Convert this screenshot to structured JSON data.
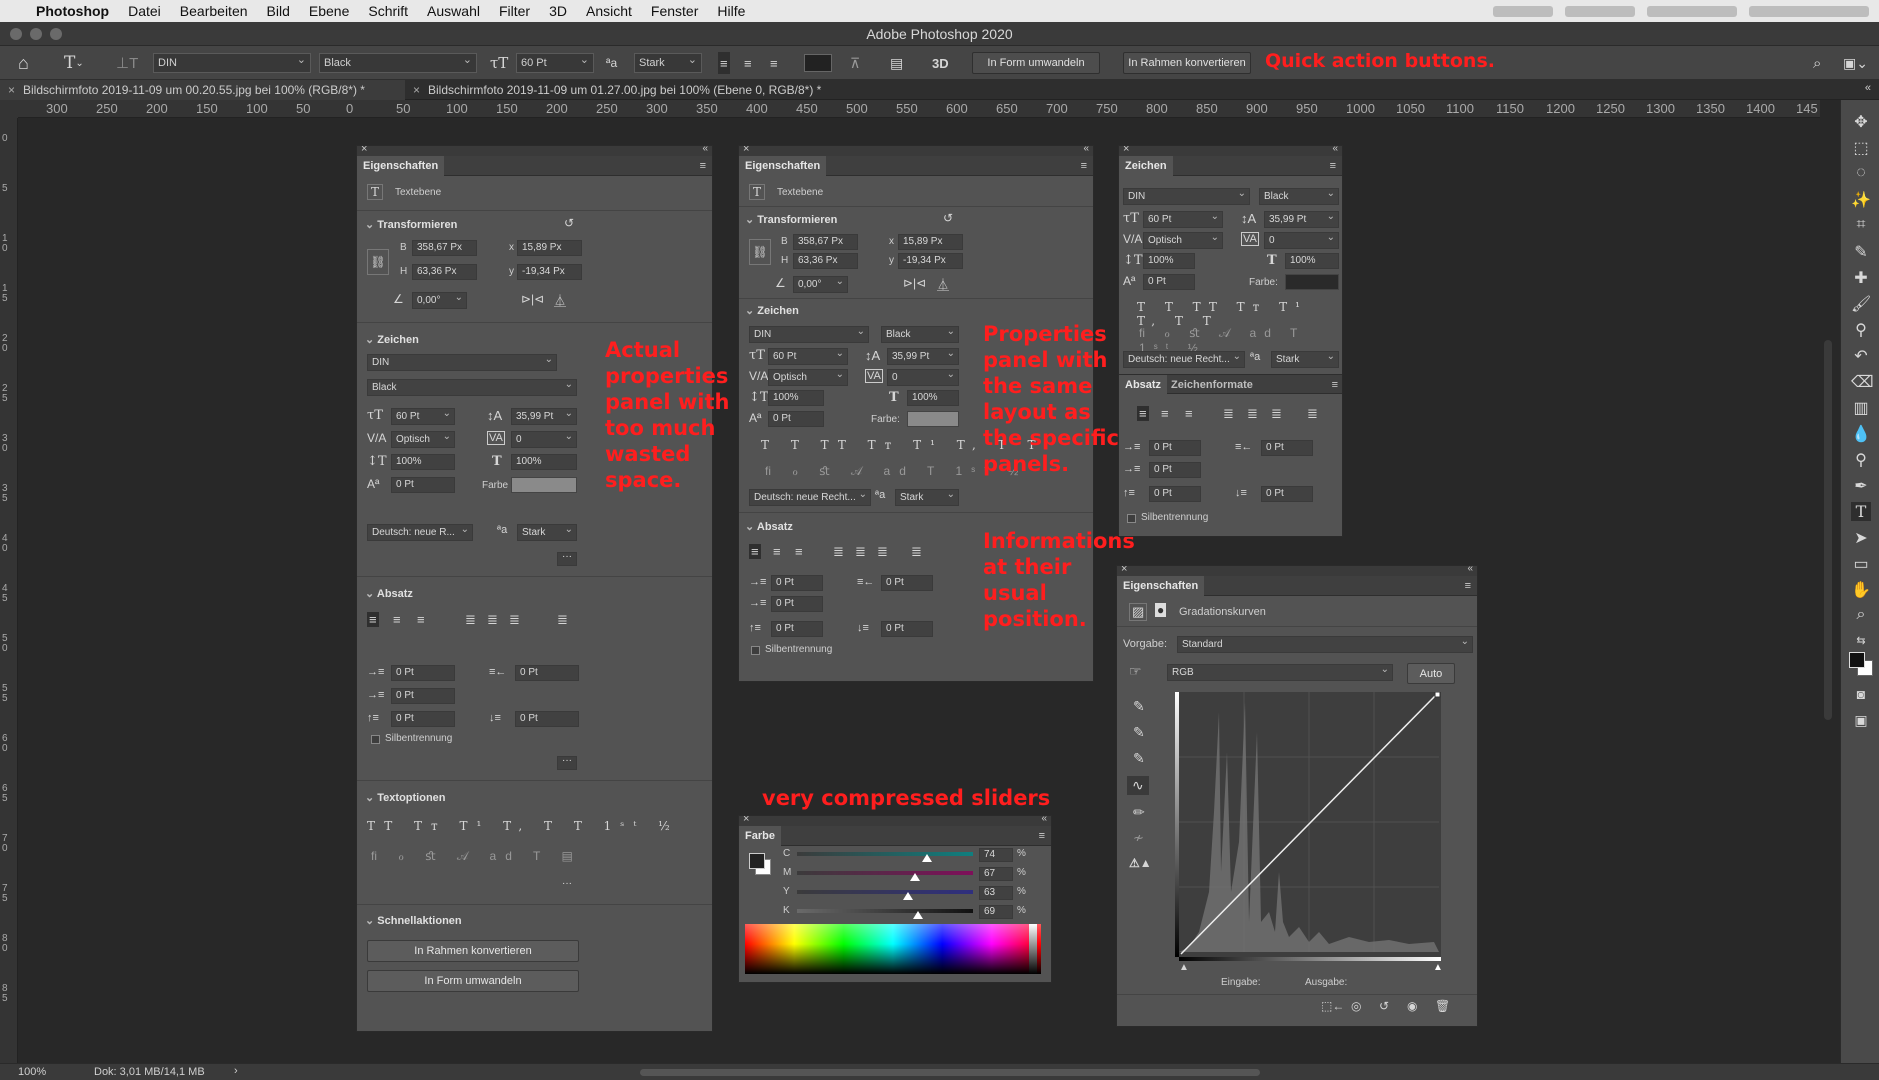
{
  "menubar": {
    "app": "Photoshop",
    "items": [
      "Datei",
      "Bearbeiten",
      "Bild",
      "Ebene",
      "Schrift",
      "Auswahl",
      "Filter",
      "3D",
      "Ansicht",
      "Fenster",
      "Hilfe"
    ]
  },
  "window_title": "Adobe Photoshop 2020",
  "options_bar": {
    "font_family": "DIN",
    "font_style": "Black",
    "font_size": "60 Pt",
    "antialias": "Stark",
    "btn_3d": "3D",
    "btn_convert_shape": "In Form umwandeln",
    "btn_convert_frame": "In Rahmen konvertieren",
    "annotation": "Quick action buttons."
  },
  "tabs": [
    {
      "label": "Bildschirmfoto 2019-11-09 um 00.20.55.jpg bei 100% (RGB/8*) *"
    },
    {
      "label": "Bildschirmfoto 2019-11-09 um 01.27.00.jpg bei 100% (Ebene 0, RGB/8*) *"
    }
  ],
  "ruler_top": [
    "300",
    "250",
    "200",
    "150",
    "100",
    "50",
    "0",
    "50",
    "100",
    "150",
    "200",
    "250",
    "300",
    "350",
    "400",
    "450",
    "500",
    "550",
    "600",
    "650",
    "700",
    "750",
    "800",
    "850",
    "900",
    "950",
    "1000",
    "1050",
    "1100",
    "1150",
    "1200",
    "1250",
    "1300",
    "1350",
    "1400",
    "145"
  ],
  "ruler_left": [
    "0",
    "5",
    "1 0",
    "1 5",
    "2 0",
    "2 5",
    "3 0",
    "3 5",
    "4 0",
    "4 5",
    "5 0",
    "5 5",
    "6 0",
    "6 5",
    "7 0",
    "7 5",
    "8 0",
    "8 5"
  ],
  "props_big": {
    "title": "Eigenschaften",
    "layer_type": "Textebene",
    "sec_transform": "Transformieren",
    "b_label": "B",
    "b_value": "358,67 Px",
    "x_label": "x",
    "x_value": "15,89 Px",
    "h_label": "H",
    "h_value": "63,36 Px",
    "y_label": "y",
    "y_value": "-19,34 Px",
    "angle": "0,00°",
    "sec_char": "Zeichen",
    "font": "DIN",
    "style": "Black",
    "size": "60 Pt",
    "leading": "35,99 Pt",
    "kerning": "Optisch",
    "tracking": "0",
    "vscale": "100%",
    "hscale": "100%",
    "baseline": "0 Pt",
    "color_label": "Farbe",
    "language": "Deutsch: neue R...",
    "aa": "Stark",
    "sec_para": "Absatz",
    "indent1": "0 Pt",
    "indent2": "0 Pt",
    "indent3": "0 Pt",
    "indent4": "0 Pt",
    "indent5": "0 Pt",
    "hyphen": "Silbentrennung",
    "sec_textopt": "Textoptionen",
    "sec_quick": "Schnellaktionen",
    "btn_frame": "In Rahmen konvertieren",
    "btn_shape": "In Form umwandeln",
    "more": "···"
  },
  "ann_big": "Actual properties panel with too much wasted space.",
  "props_mid": {
    "title": "Eigenschaften",
    "layer_type": "Textebene",
    "sec_transform": "Transformieren",
    "b_label": "B",
    "b_value": "358,67 Px",
    "x_label": "x",
    "x_value": "15,89 Px",
    "h_label": "H",
    "h_value": "63,36 Px",
    "y_label": "y",
    "y_value": "-19,34 Px",
    "angle": "0,00°",
    "sec_char": "Zeichen",
    "font": "DIN",
    "style": "Black",
    "size": "60 Pt",
    "leading": "35,99 Pt",
    "kerning": "Optisch",
    "tracking": "0",
    "vscale": "100%",
    "hscale": "100%",
    "baseline": "0 Pt",
    "color_label": "Farbe:",
    "language": "Deutsch: neue Recht...",
    "aa": "Stark",
    "sec_para": "Absatz",
    "indent1": "0 Pt",
    "indent2": "0 Pt",
    "indent3": "0 Pt",
    "indent4": "0 Pt",
    "indent5": "0 Pt",
    "hyphen": "Silbentrennung"
  },
  "ann_mid1": "Properties panel with the same layout as the specific panels.",
  "ann_mid2": "Informations at their usual position.",
  "ann_sliders": "very compressed sliders",
  "color_panel": {
    "title": "Farbe",
    "channels": [
      {
        "label": "C",
        "value": "74",
        "unit": "%",
        "level": 0.74
      },
      {
        "label": "M",
        "value": "67",
        "unit": "%",
        "level": 0.67
      },
      {
        "label": "Y",
        "value": "63",
        "unit": "%",
        "level": 0.63
      },
      {
        "label": "K",
        "value": "69",
        "unit": "%",
        "level": 0.69
      }
    ]
  },
  "char_panel": {
    "title": "Zeichen",
    "font": "DIN",
    "style": "Black",
    "size": "60 Pt",
    "leading": "35,99 Pt",
    "kerning": "Optisch",
    "tracking": "0",
    "vscale": "100%",
    "hscale": "100%",
    "baseline": "0 Pt",
    "color_label": "Farbe:",
    "language": "Deutsch: neue Recht...",
    "aa": "Stark",
    "tab_para": "Absatz",
    "tab_charstyles": "Zeichenformate",
    "indent1": "0 Pt",
    "indent2": "0 Pt",
    "indent3": "0 Pt",
    "indent4": "0 Pt",
    "indent5": "0 Pt",
    "hyphen": "Silbentrennung"
  },
  "curves_panel": {
    "title": "Eigenschaften",
    "adjustment": "Gradationskurven",
    "preset_label": "Vorgabe:",
    "preset": "Standard",
    "channel": "RGB",
    "auto": "Auto",
    "input_label": "Eingabe:",
    "output_label": "Ausgabe:"
  },
  "status": {
    "zoom": "100%",
    "doc": "Dok: 3,01 MB/14,1 MB"
  }
}
